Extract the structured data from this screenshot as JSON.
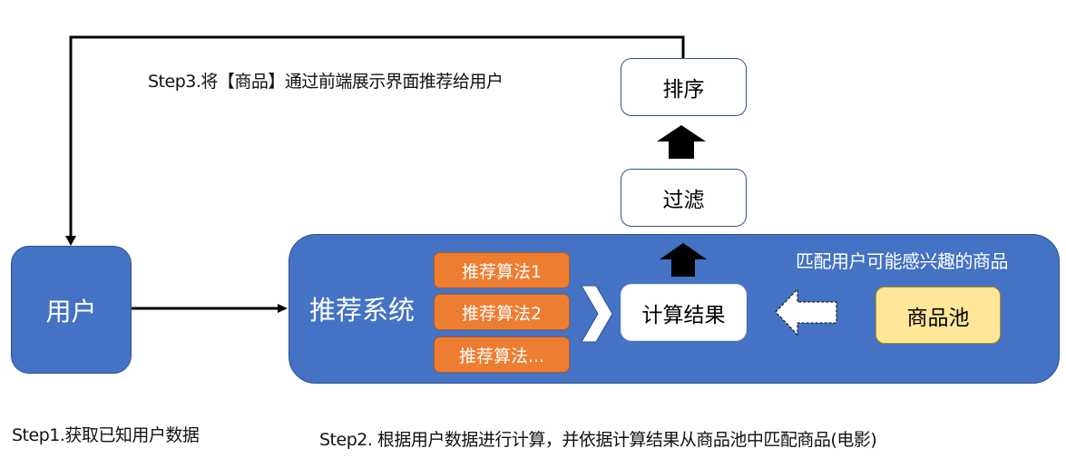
{
  "steps": {
    "step1": "Step1.获取已知用户数据",
    "step2": "Step2. 根据用户数据进行计算，并依据计算结果从商品池中匹配商品(电影)",
    "step3": "Step3.将【商品】通过前端展示界面推荐给用户"
  },
  "nodes": {
    "user": "用户",
    "recommender_system": "推荐系统",
    "match_note": "匹配用户可能感兴趣的商品",
    "algorithms": [
      "推荐算法1",
      "推荐算法2",
      "推荐算法..."
    ],
    "compute_result": "计算结果",
    "item_pool": "商品池",
    "filter": "过滤",
    "sort": "排序"
  },
  "colors": {
    "primary_blue": "#4472C4",
    "algorithm_orange": "#ED7D31",
    "pool_yellow": "#FFE699",
    "arrow_black": "#000000"
  }
}
